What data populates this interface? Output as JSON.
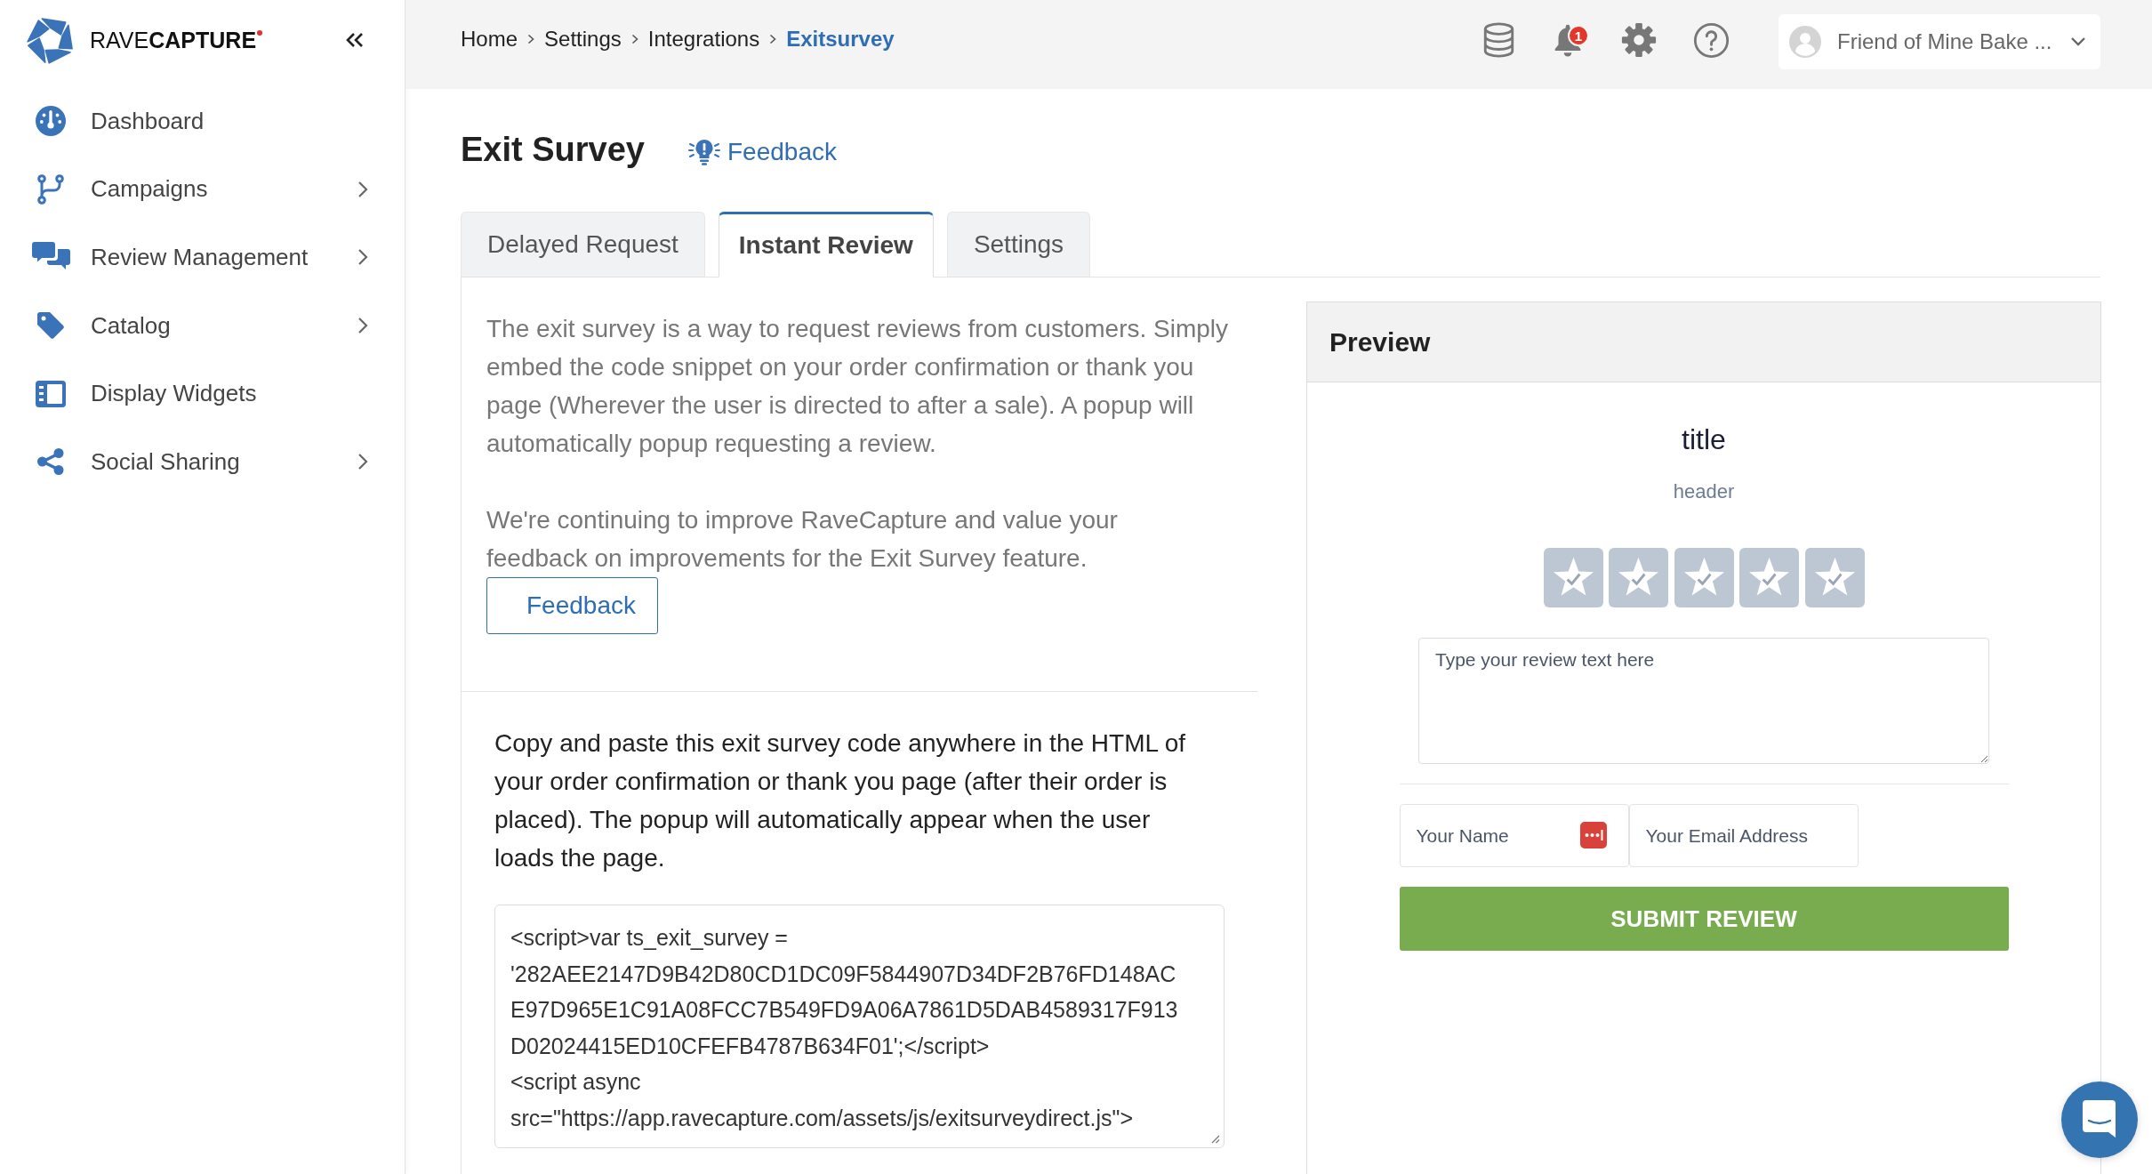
{
  "sidebar": {
    "logo": "RAVE**CAPTURE**",
    "items": [
      {
        "label": "Dashboard",
        "has_submenu": false,
        "selected": false
      },
      {
        "label": "Campaigns",
        "has_submenu": true,
        "selected": false
      },
      {
        "label": "Review Management",
        "has_submenu": true,
        "selected": false
      },
      {
        "label": "Catalog",
        "has_submenu": true,
        "selected": false
      },
      {
        "label": "Display Widgets",
        "has_submenu": false,
        "selected": false
      },
      {
        "label": "Social Sharing",
        "has_submenu": true,
        "selected": false
      }
    ]
  },
  "breadcrumb": [
    {
      "label": "Home",
      "selected": false
    },
    {
      "label": "Settings",
      "selected": false
    },
    {
      "label": "Integrations",
      "selected": false
    },
    {
      "label": "Exitsurvey",
      "selected": true
    }
  ],
  "topbar": {
    "notification_count": "1",
    "account_name": "Friend of Mine Bake ..."
  },
  "page": {
    "title": "Exit Survey",
    "feedback_link": "Feedback"
  },
  "tabs": [
    {
      "label": "Delayed Request",
      "selected": false
    },
    {
      "label": "Instant Review",
      "selected": true
    },
    {
      "label": "Settings",
      "selected": false
    }
  ],
  "intro": {
    "paragraphs": [
      "The exit survey is a way to request reviews from customers. Simply embed the code snippet on your order confirmation or thank you page (Wherever the user is directed to after a sale). A popup will automatically popup requesting a review.",
      "We're continuing to improve RaveCapture and value your feedback on improvements for the Exit Survey feature."
    ],
    "feedback_button": "Feedback"
  },
  "embed": {
    "instructions": "Copy and paste this exit survey code anywhere in the HTML of your order confirmation or thank you page (after their order is placed). The popup will automatically appear when the user loads the page.",
    "code_field": {
      "lines": [
        "<script>var ts_exit_survey =",
        "'282AEE2147D9B42D80CD1DC09F5844907D34DF2B76FD148AC",
        "E97D965E1C91A08FCC7B549FD9A06A7861D5DAB4589317F913",
        "D02024415ED10CFEFB4787B634F01';</script>",
        "<script async",
        "src=\"https://app.ravecapture.com/assets/js/exitsurveydirect.js\">"
      ]
    }
  },
  "preview": {
    "heading": "Preview",
    "title": "title",
    "header": "header",
    "review_field": {
      "placeholder": "Type your review text here"
    },
    "name_field": {
      "placeholder": "Your Name"
    },
    "email_field": {
      "placeholder": "Your Email Address"
    },
    "submit_button": "SUBMIT REVIEW"
  }
}
